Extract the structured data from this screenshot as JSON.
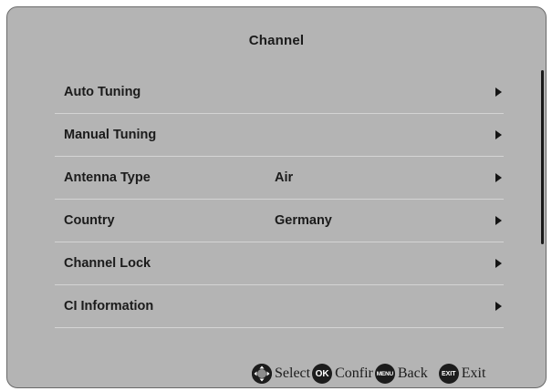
{
  "menu": {
    "title": "Channel",
    "items": [
      {
        "label": "Auto Tuning",
        "value": ""
      },
      {
        "label": "Manual Tuning",
        "value": ""
      },
      {
        "label": "Antenna Type",
        "value": "Air"
      },
      {
        "label": "Country",
        "value": "Germany"
      },
      {
        "label": "Channel Lock",
        "value": ""
      },
      {
        "label": "CI Information",
        "value": ""
      }
    ]
  },
  "footer": {
    "select_label": "Select",
    "ok_icon": "OK",
    "confirm_label": "Confir",
    "menu_icon": "MENU",
    "back_label": "Back",
    "exit_icon": "EXIT",
    "exit_label": "Exit"
  },
  "colors": {
    "panel_background": "#b4b4b4",
    "row_divider": "#d4d4d4",
    "text": "#1b1b1b",
    "icon_background": "#1c1c1c"
  },
  "icons": {
    "row_arrow": "arrow-right-icon",
    "select": "dpad-icon",
    "confirm": "ok-button-icon",
    "back": "menu-button-icon",
    "exit": "exit-button-icon"
  }
}
